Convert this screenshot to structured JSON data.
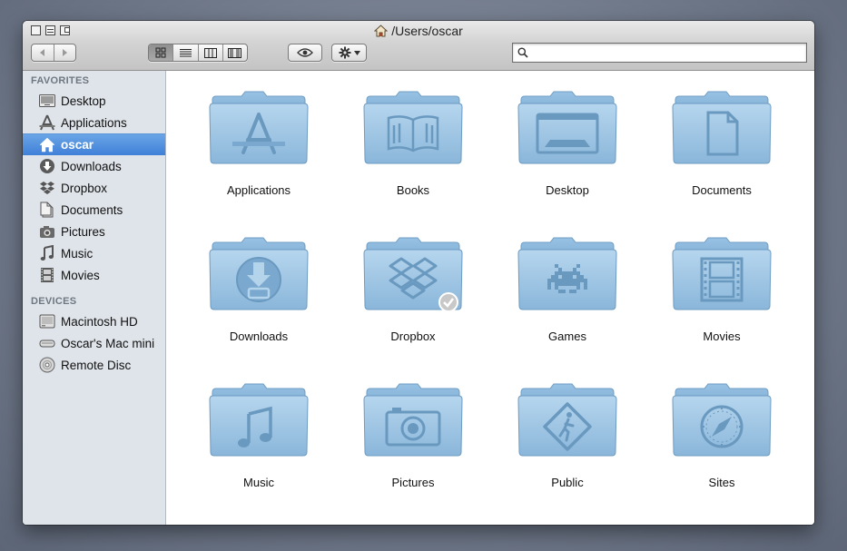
{
  "window": {
    "title": "/Users/oscar"
  },
  "toolbar": {
    "back_label": "◀",
    "forward_label": "▶",
    "view_modes": [
      "icon-view",
      "list-view",
      "column-view",
      "cover-flow-view"
    ],
    "active_view": "icon-view",
    "search_placeholder": "",
    "search_value": ""
  },
  "sidebar": {
    "favorites_header": "FAVORITES",
    "favorites": [
      {
        "label": "Desktop",
        "icon": "desktop-icon"
      },
      {
        "label": "Applications",
        "icon": "applications-icon"
      },
      {
        "label": "oscar",
        "icon": "home-icon",
        "selected": true
      },
      {
        "label": "Downloads",
        "icon": "downloads-icon"
      },
      {
        "label": "Dropbox",
        "icon": "dropbox-icon"
      },
      {
        "label": "Documents",
        "icon": "documents-icon"
      },
      {
        "label": "Pictures",
        "icon": "camera-icon"
      },
      {
        "label": "Music",
        "icon": "music-note-icon"
      },
      {
        "label": "Movies",
        "icon": "film-icon"
      }
    ],
    "devices_header": "DEVICES",
    "devices": [
      {
        "label": "Macintosh HD",
        "icon": "hard-drive-icon"
      },
      {
        "label": "Oscar's Mac mini",
        "icon": "mac-mini-icon"
      },
      {
        "label": "Remote Disc",
        "icon": "disc-icon"
      }
    ]
  },
  "folders": [
    {
      "label": "Applications",
      "glyph": "applications"
    },
    {
      "label": "Books",
      "glyph": "book"
    },
    {
      "label": "Desktop",
      "glyph": "desktop"
    },
    {
      "label": "Documents",
      "glyph": "document"
    },
    {
      "label": "Downloads",
      "glyph": "download"
    },
    {
      "label": "Dropbox",
      "glyph": "dropbox"
    },
    {
      "label": "Games",
      "glyph": "invader"
    },
    {
      "label": "Movies",
      "glyph": "film"
    },
    {
      "label": "Music",
      "glyph": "music"
    },
    {
      "label": "Pictures",
      "glyph": "camera"
    },
    {
      "label": "Public",
      "glyph": "pedestrian"
    },
    {
      "label": "Sites",
      "glyph": "compass"
    }
  ],
  "colors": {
    "selection": "#3f80d8",
    "folder_blue": "#9ec6e4",
    "sidebar_bg": "#dfe4ea"
  }
}
